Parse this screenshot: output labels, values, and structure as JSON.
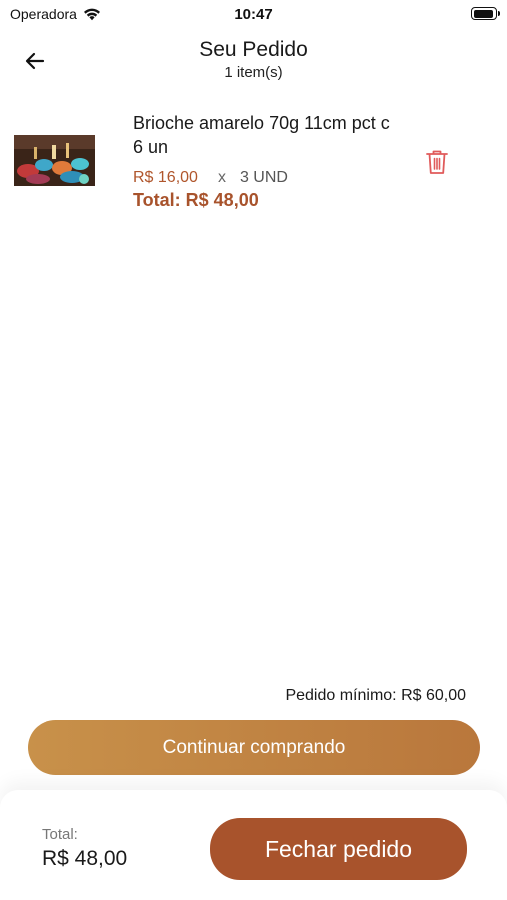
{
  "status_bar": {
    "carrier": "Operadora",
    "time": "10:47",
    "icons": [
      "wifi-icon",
      "battery-icon"
    ]
  },
  "header": {
    "back_icon": "arrow-left-icon",
    "title": "Seu Pedido",
    "subtitle": "1 item(s)"
  },
  "cart": {
    "items": [
      {
        "name": "Brioche amarelo 70g 11cm pct c 6 un",
        "unit_price": "R$ 16,00",
        "times": "x",
        "quantity": "3 UND",
        "total": "Total: R$ 48,00",
        "delete_icon": "trash-icon"
      }
    ]
  },
  "summary": {
    "minimum_order": "Pedido mínimo: R$ 60,00",
    "continue_label": "Continuar comprando",
    "total_label": "Total:",
    "total_value": "R$ 48,00",
    "checkout_label": "Fechar pedido"
  },
  "colors": {
    "accent": "#a8532c",
    "continue_button": "#c08244",
    "delete_icon": "#e05a5a"
  }
}
